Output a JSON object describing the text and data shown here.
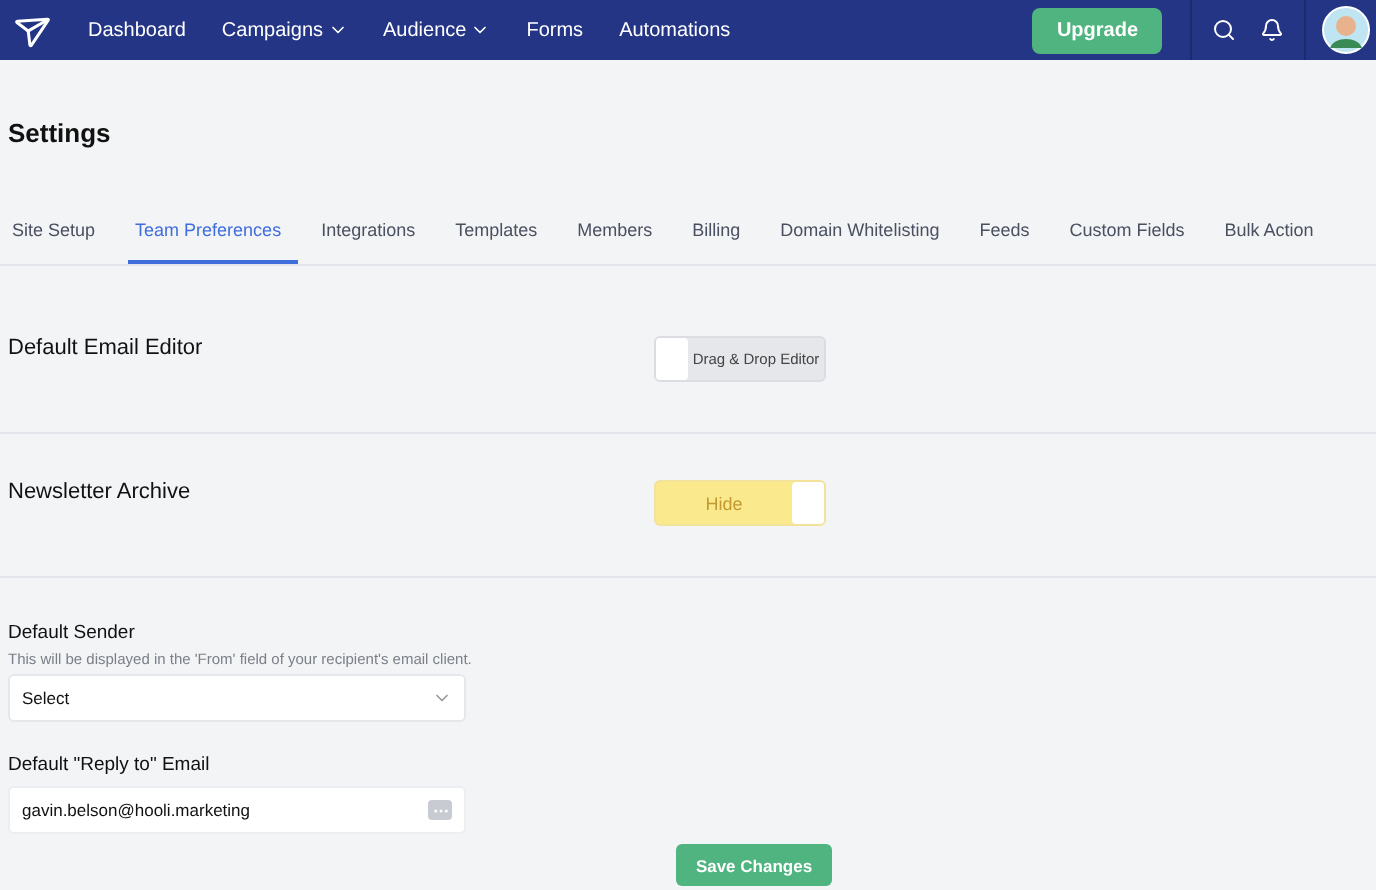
{
  "nav": {
    "items": [
      {
        "label": "Dashboard",
        "has_menu": false
      },
      {
        "label": "Campaigns",
        "has_menu": true
      },
      {
        "label": "Audience",
        "has_menu": true
      },
      {
        "label": "Forms",
        "has_menu": false
      },
      {
        "label": "Automations",
        "has_menu": false
      }
    ],
    "upgrade": "Upgrade"
  },
  "page_title": "Settings",
  "tabs": [
    {
      "label": "Site Setup",
      "selected": false
    },
    {
      "label": "Team Preferences",
      "selected": true
    },
    {
      "label": "Integrations",
      "selected": false
    },
    {
      "label": "Templates",
      "selected": false
    },
    {
      "label": "Members",
      "selected": false
    },
    {
      "label": "Billing",
      "selected": false
    },
    {
      "label": "Domain Whitelisting",
      "selected": false
    },
    {
      "label": "Feeds",
      "selected": false
    },
    {
      "label": "Custom Fields",
      "selected": false
    },
    {
      "label": "Bulk Action",
      "selected": false
    }
  ],
  "toggles": [
    {
      "label": "Default Email Editor",
      "value": "Drag & Drop Editor",
      "on": false
    },
    {
      "label": "Newsletter Archive",
      "value": "Hide",
      "on": true
    }
  ],
  "default_sender": {
    "label": "Default Sender",
    "hint": "This will be displayed in the 'From' field of your recipient's email client.",
    "value": "Select"
  },
  "reply_to": {
    "label": "Default \"Reply to\" Email",
    "value": "gavin.belson@hooli.marketing"
  },
  "save_button": "Save Changes"
}
